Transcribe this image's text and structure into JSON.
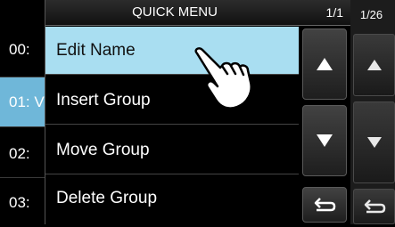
{
  "background": {
    "channels": [
      {
        "label": "00:"
      },
      {
        "label": "01: V",
        "selected": true
      },
      {
        "label": "02:"
      },
      {
        "label": "03:"
      }
    ],
    "page_count": "1/26"
  },
  "quick_menu": {
    "title": "QUICK MENU",
    "page": "1/1",
    "items": [
      {
        "label": "Edit Name",
        "highlighted": true
      },
      {
        "label": "Insert Group"
      },
      {
        "label": "Move Group"
      },
      {
        "label": "Delete Group"
      }
    ]
  },
  "icons": {
    "scroll_up": "up-triangle",
    "scroll_down": "down-triangle",
    "back": "return-arrow",
    "pointer": "pointing-hand"
  },
  "colors": {
    "highlight": "#a9def1",
    "selected_row": "#6fb7d9"
  }
}
